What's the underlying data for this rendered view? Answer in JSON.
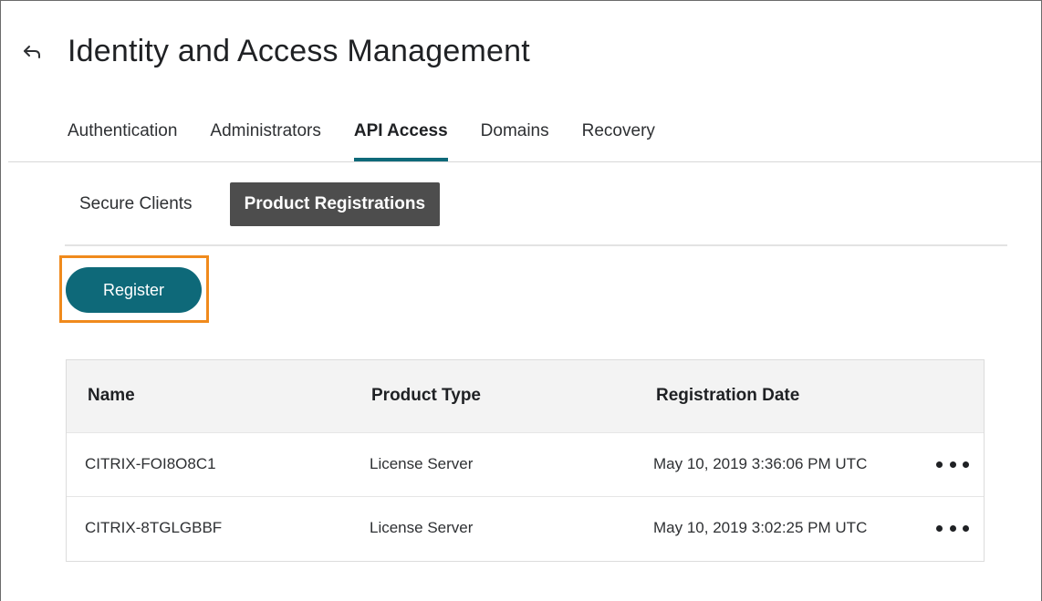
{
  "header": {
    "back_icon": "back-arrow-icon",
    "title": "Identity and Access Management"
  },
  "tabs": [
    {
      "label": "Authentication",
      "active": false
    },
    {
      "label": "Administrators",
      "active": false
    },
    {
      "label": "API Access",
      "active": true
    },
    {
      "label": "Domains",
      "active": false
    },
    {
      "label": "Recovery",
      "active": false
    }
  ],
  "subtabs": [
    {
      "label": "Secure Clients",
      "active": false
    },
    {
      "label": "Product Registrations",
      "active": true
    }
  ],
  "actions": {
    "register_label": "Register"
  },
  "table": {
    "columns": [
      "Name",
      "Product Type",
      "Registration Date"
    ],
    "rows": [
      {
        "name": "CITRIX-FOI8O8C1",
        "product_type": "License Server",
        "registration_date": "May 10, 2019 3:36:06 PM UTC",
        "more_icon": "more-horizontal-icon"
      },
      {
        "name": "CITRIX-8TGLGBBF",
        "product_type": "License Server",
        "registration_date": "May 10, 2019 3:02:25 PM UTC",
        "more_icon": "more-horizontal-icon"
      }
    ]
  },
  "colors": {
    "accent": "#0e6979",
    "active_subtab_bg": "#4d4d4d",
    "highlight": "#f08a1c"
  }
}
